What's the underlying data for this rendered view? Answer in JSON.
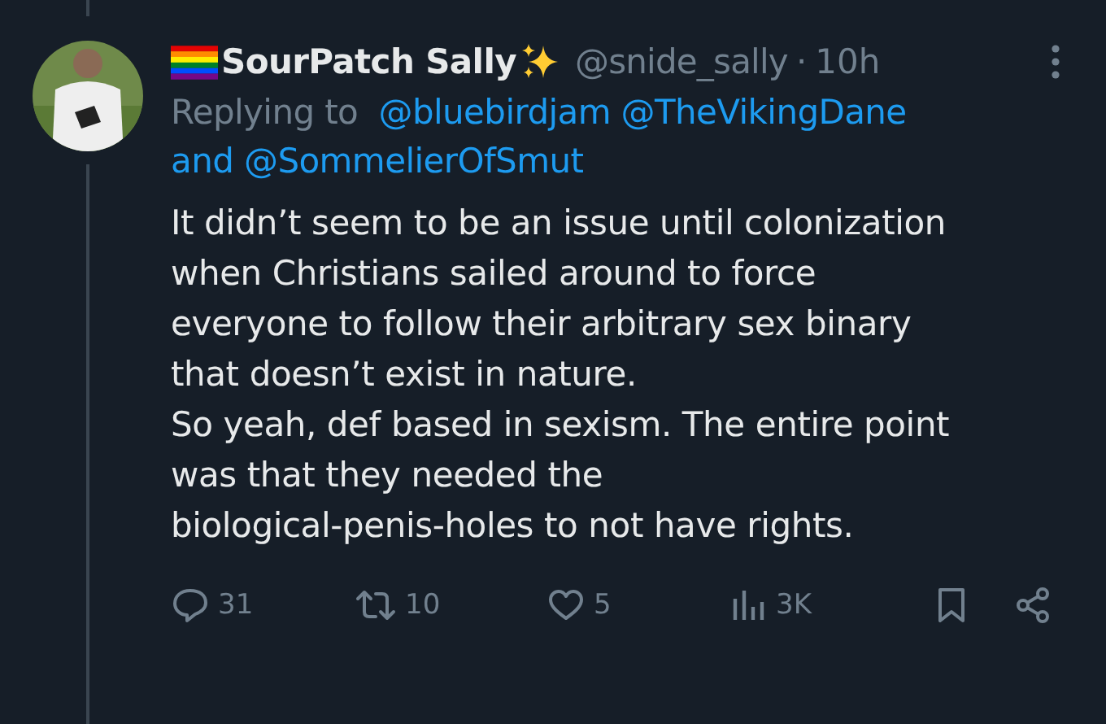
{
  "author": {
    "name": "SourPatch Sally",
    "handle": "@snide_sally",
    "separator": "·",
    "time": "10h"
  },
  "reply_context": {
    "prefix": "Replying to",
    "mentions": [
      "@bluebirdjam",
      "@TheVikingDane"
    ],
    "joiner": "and",
    "last_mention": "@SommelierOfSmut"
  },
  "body": [
    "It didn’t seem to be an issue until colonization\nwhen Christians sailed around to force\neveryone to follow their arbitrary sex binary\nthat doesn’t exist in nature.",
    "So yeah, def based in sexism. The entire point\nwas that they needed the\nbiological-penis-holes to not have rights."
  ],
  "actions": [
    {
      "kind": "reply",
      "count": "31"
    },
    {
      "kind": "retweet",
      "count": "10"
    },
    {
      "kind": "like",
      "count": "5"
    },
    {
      "kind": "views",
      "count": "3K"
    },
    {
      "kind": "bookmark"
    },
    {
      "kind": "share"
    }
  ]
}
